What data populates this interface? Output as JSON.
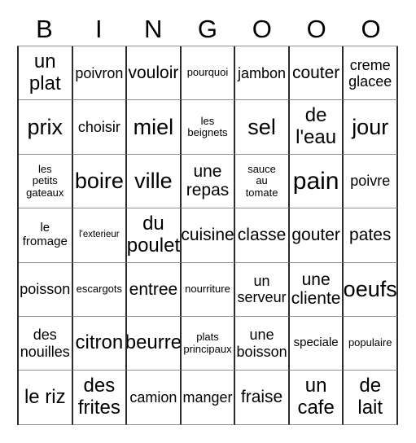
{
  "card": {
    "title": "BINGOOO",
    "header": [
      {
        "label": "B"
      },
      {
        "label": "I"
      },
      {
        "label": "N"
      },
      {
        "label": "G"
      },
      {
        "label": "O"
      },
      {
        "label": "O"
      },
      {
        "label": "O"
      }
    ],
    "colors": {
      "vertical_border": "#2b2b2b",
      "horizontal_border": "#8f8f8f",
      "text": "#000000",
      "background": "#ffffff"
    },
    "rows": [
      [
        {
          "text": "un\nplat",
          "size": "lg"
        },
        {
          "text": "poivron",
          "size": "sm"
        },
        {
          "text": "vouloir",
          "size": "md"
        },
        {
          "text": "pourquoi",
          "size": "xxs"
        },
        {
          "text": "jambon",
          "size": "sm"
        },
        {
          "text": "couter",
          "size": "md"
        },
        {
          "text": "creme\nglacee",
          "size": "sm"
        }
      ],
      [
        {
          "text": "prix",
          "size": "xl"
        },
        {
          "text": "choisir",
          "size": "sm"
        },
        {
          "text": "miel",
          "size": "xl"
        },
        {
          "text": "les\nbeignets",
          "size": "xxs"
        },
        {
          "text": "sel",
          "size": "xl"
        },
        {
          "text": "de\nl'eau",
          "size": "lg"
        },
        {
          "text": "jour",
          "size": "xl"
        }
      ],
      [
        {
          "text": "les\npetits\ngateaux",
          "size": "xxs"
        },
        {
          "text": "boire",
          "size": "xl"
        },
        {
          "text": "ville",
          "size": "xl"
        },
        {
          "text": "une\nrepas",
          "size": "md"
        },
        {
          "text": "sauce\nau\ntomate",
          "size": "xxs"
        },
        {
          "text": "pain",
          "size": "xxl"
        },
        {
          "text": "poivre",
          "size": "sm"
        }
      ],
      [
        {
          "text": "le\nfromage",
          "size": "xs"
        },
        {
          "text": "l'exterieur",
          "size": "tiny"
        },
        {
          "text": "du\npoulet",
          "size": "lg"
        },
        {
          "text": "cuisine",
          "size": "md"
        },
        {
          "text": "classe",
          "size": "md"
        },
        {
          "text": "gouter",
          "size": "md"
        },
        {
          "text": "pates",
          "size": "md"
        }
      ],
      [
        {
          "text": "poisson",
          "size": "sm"
        },
        {
          "text": "escargots",
          "size": "xxs"
        },
        {
          "text": "entree",
          "size": "md"
        },
        {
          "text": "nourriture",
          "size": "xxs"
        },
        {
          "text": "un\nserveur",
          "size": "sm"
        },
        {
          "text": "une\ncliente",
          "size": "md"
        },
        {
          "text": "oeufs",
          "size": "xl"
        }
      ],
      [
        {
          "text": "des\nnouilles",
          "size": "sm"
        },
        {
          "text": "citron",
          "size": "lg"
        },
        {
          "text": "beurre",
          "size": "lg"
        },
        {
          "text": "plats\nprincipaux",
          "size": "xxs"
        },
        {
          "text": "une\nboisson",
          "size": "sm"
        },
        {
          "text": "speciale",
          "size": "xs"
        },
        {
          "text": "populaire",
          "size": "xxs"
        }
      ],
      [
        {
          "text": "le riz",
          "size": "lg"
        },
        {
          "text": "des\nfrites",
          "size": "lg"
        },
        {
          "text": "camion",
          "size": "sm"
        },
        {
          "text": "manger",
          "size": "sm"
        },
        {
          "text": "fraise",
          "size": "md"
        },
        {
          "text": "un\ncafe",
          "size": "lg"
        },
        {
          "text": "de\nlait",
          "size": "lg"
        }
      ]
    ]
  }
}
